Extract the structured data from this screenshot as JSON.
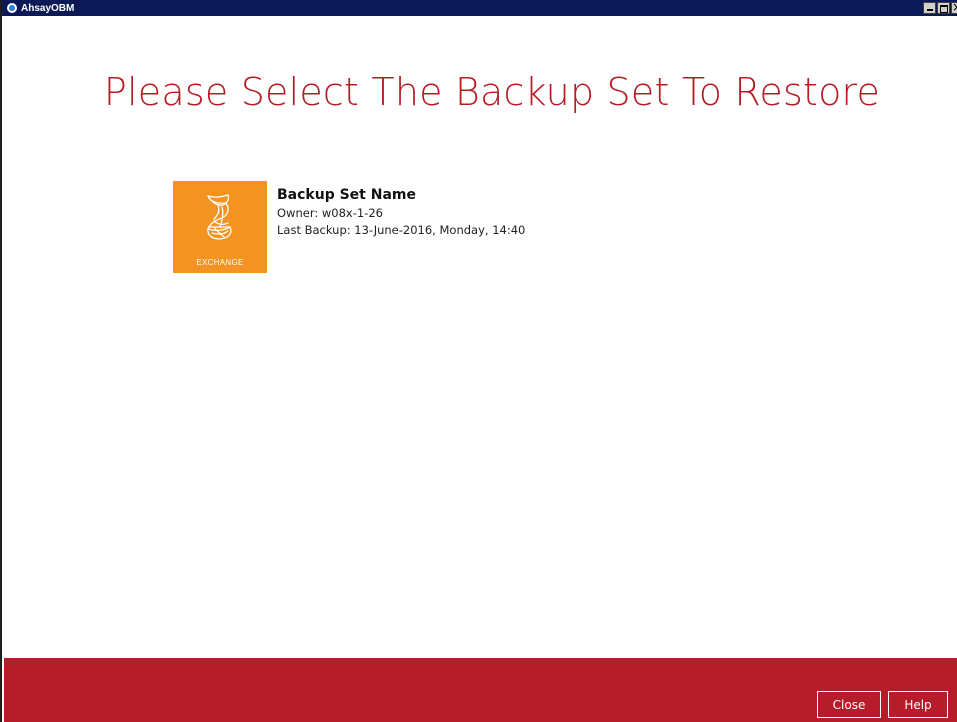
{
  "window": {
    "title": "AhsayOBM"
  },
  "main": {
    "heading": "Please Select The Backup Set To Restore"
  },
  "backup_sets": [
    {
      "name": "Backup Set Name",
      "owner": "Owner: w08x-1-26",
      "last_backup": "Last Backup: 13-June-2016, Monday, 14:40",
      "type_label": "EXCHANGE",
      "icon": "exchange-icon"
    }
  ],
  "footer": {
    "close_label": "Close",
    "help_label": "Help"
  },
  "colors": {
    "accent_red": "#b71c24",
    "footer_red": "#b71c2a",
    "tile_orange": "#f39321",
    "titlebar_navy": "#0b1a57"
  }
}
